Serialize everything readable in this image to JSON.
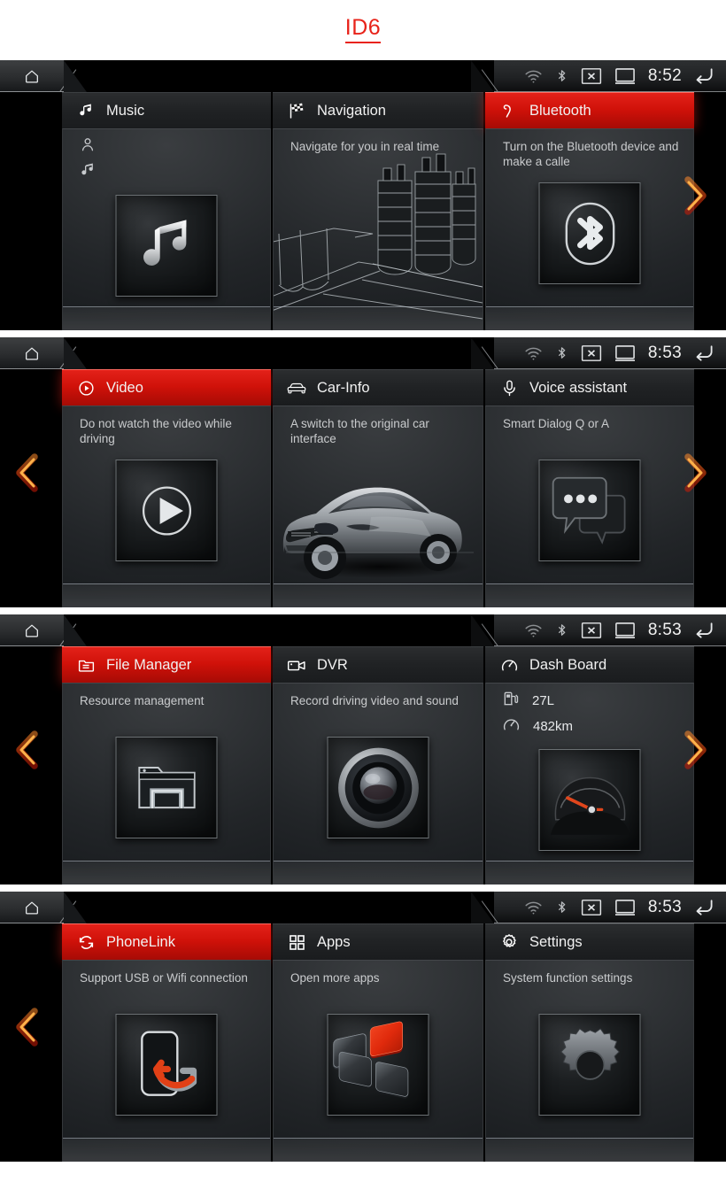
{
  "title": {
    "text": "ID6"
  },
  "accent_colors": {
    "brand_red": "#e8231a",
    "header_red": "#cf1109",
    "arrow_orange": "#ff5a14"
  },
  "status_bar": {
    "home_icon": "home-icon",
    "icons": [
      "wifi-icon",
      "bluetooth-icon",
      "x-box-icon",
      "screen-icon"
    ],
    "back_icon": "back-arrow-icon"
  },
  "panels": [
    {
      "time": "8:52",
      "arrows": {
        "left": false,
        "right": true
      },
      "cards": [
        {
          "title": "Music",
          "icon": "music-note-icon",
          "highlighted": false,
          "desc": "",
          "sub_items": [
            {
              "icon": "person-icon",
              "value": ""
            },
            {
              "icon": "music-note-icon",
              "value": ""
            }
          ],
          "thumb": "music-note-thumb"
        },
        {
          "title": "Navigation",
          "icon": "checkered-flag-icon",
          "highlighted": false,
          "desc": "Navigate for you in real time",
          "sub_items": [],
          "thumb": "city-map-thumb"
        },
        {
          "title": "Bluetooth",
          "icon": "phone-handset-icon",
          "highlighted": true,
          "desc": "Turn on the Bluetooth device and make a calle",
          "sub_items": [],
          "thumb": "bluetooth-thumb"
        }
      ]
    },
    {
      "time": "8:53",
      "arrows": {
        "left": true,
        "right": true
      },
      "cards": [
        {
          "title": "Video",
          "icon": "play-circle-icon",
          "highlighted": true,
          "desc": "Do not watch the video while driving",
          "sub_items": [],
          "thumb": "play-button-thumb"
        },
        {
          "title": "Car-Info",
          "icon": "car-front-icon",
          "highlighted": false,
          "desc": "A switch to the original car interface",
          "sub_items": [],
          "thumb": "sedan-photo-thumb"
        },
        {
          "title": "Voice assistant",
          "icon": "microphone-icon",
          "highlighted": false,
          "desc": "Smart Dialog Q or A",
          "sub_items": [],
          "thumb": "speech-bubble-thumb"
        }
      ]
    },
    {
      "time": "8:53",
      "arrows": {
        "left": true,
        "right": true
      },
      "cards": [
        {
          "title": "File Manager",
          "icon": "folder-lines-icon",
          "highlighted": true,
          "desc": "Resource management",
          "sub_items": [],
          "thumb": "folder-thumb"
        },
        {
          "title": "DVR",
          "icon": "video-camera-icon",
          "highlighted": false,
          "desc": "Record driving video and sound",
          "sub_items": [],
          "thumb": "camera-lens-thumb"
        },
        {
          "title": "Dash Board",
          "icon": "gauge-icon",
          "highlighted": false,
          "desc": "",
          "sub_items": [
            {
              "icon": "fuel-pump-icon",
              "value": "27L"
            },
            {
              "icon": "gauge-icon",
              "value": "482km"
            }
          ],
          "thumb": "speedometer-thumb"
        }
      ]
    },
    {
      "time": "8:53",
      "arrows": {
        "left": true,
        "right": false
      },
      "cards": [
        {
          "title": "PhoneLink",
          "icon": "sync-arrows-icon",
          "highlighted": true,
          "desc": "Support USB or Wifi connection",
          "sub_items": [],
          "thumb": "phone-sync-thumb"
        },
        {
          "title": "Apps",
          "icon": "grid-squares-icon",
          "highlighted": false,
          "desc": "Open more apps",
          "sub_items": [],
          "thumb": "app-tiles-thumb"
        },
        {
          "title": "Settings",
          "icon": "gear-icon",
          "highlighted": false,
          "desc": "System function settings",
          "sub_items": [],
          "thumb": "gear-thumb"
        }
      ]
    }
  ]
}
